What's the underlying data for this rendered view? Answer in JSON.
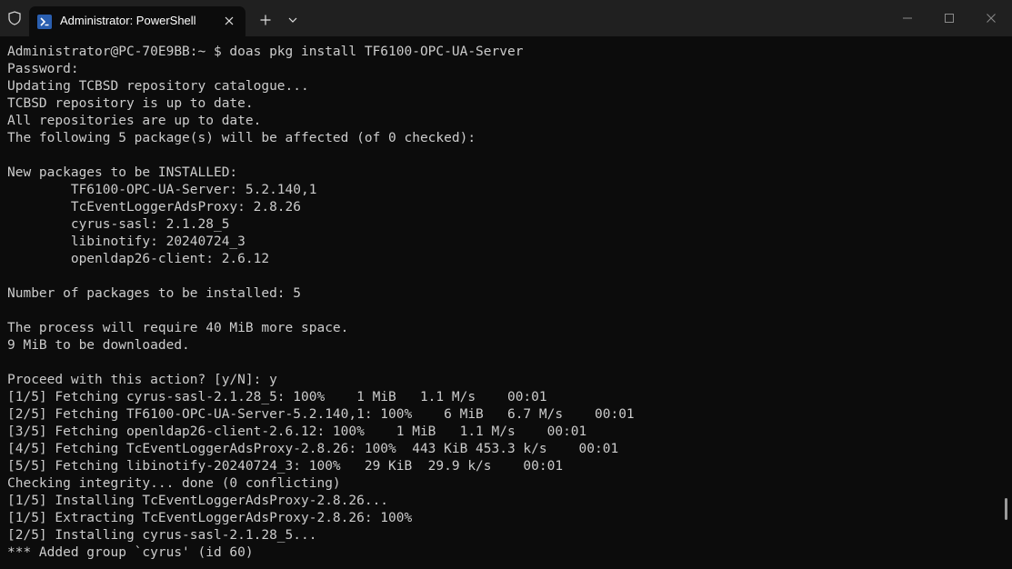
{
  "window": {
    "tab_title": "Administrator: PowerShell",
    "icons": {
      "shield": "shield-icon",
      "app": "powershell-icon",
      "tab_close": "close-icon",
      "new_tab": "plus-icon",
      "dropdown": "chevron-down-icon",
      "minimize": "minimize-icon",
      "maximize": "maximize-icon",
      "close": "close-icon"
    },
    "colors": {
      "titlebar": "#202020",
      "terminal_bg": "#0c0c0c",
      "terminal_text": "#cccccc",
      "tab_icon": "#2a5fb0"
    }
  },
  "terminal": {
    "lines": [
      "Administrator@PC-70E9BB:~ $ doas pkg install TF6100-OPC-UA-Server",
      "Password:",
      "Updating TCBSD repository catalogue...",
      "TCBSD repository is up to date.",
      "All repositories are up to date.",
      "The following 5 package(s) will be affected (of 0 checked):",
      "",
      "New packages to be INSTALLED:",
      "        TF6100-OPC-UA-Server: 5.2.140,1",
      "        TcEventLoggerAdsProxy: 2.8.26",
      "        cyrus-sasl: 2.1.28_5",
      "        libinotify: 20240724_3",
      "        openldap26-client: 2.6.12",
      "",
      "Number of packages to be installed: 5",
      "",
      "The process will require 40 MiB more space.",
      "9 MiB to be downloaded.",
      "",
      "Proceed with this action? [y/N]: y",
      "[1/5] Fetching cyrus-sasl-2.1.28_5: 100%    1 MiB   1.1 M/s    00:01",
      "[2/5] Fetching TF6100-OPC-UA-Server-5.2.140,1: 100%    6 MiB   6.7 M/s    00:01",
      "[3/5] Fetching openldap26-client-2.6.12: 100%    1 MiB   1.1 M/s    00:01",
      "[4/5] Fetching TcEventLoggerAdsProxy-2.8.26: 100%  443 KiB 453.3 k/s    00:01",
      "[5/5] Fetching libinotify-20240724_3: 100%   29 KiB  29.9 k/s    00:01",
      "Checking integrity... done (0 conflicting)",
      "[1/5] Installing TcEventLoggerAdsProxy-2.8.26...",
      "[1/5] Extracting TcEventLoggerAdsProxy-2.8.26: 100%",
      "[2/5] Installing cyrus-sasl-2.1.28_5...",
      "*** Added group `cyrus' (id 60)"
    ]
  }
}
